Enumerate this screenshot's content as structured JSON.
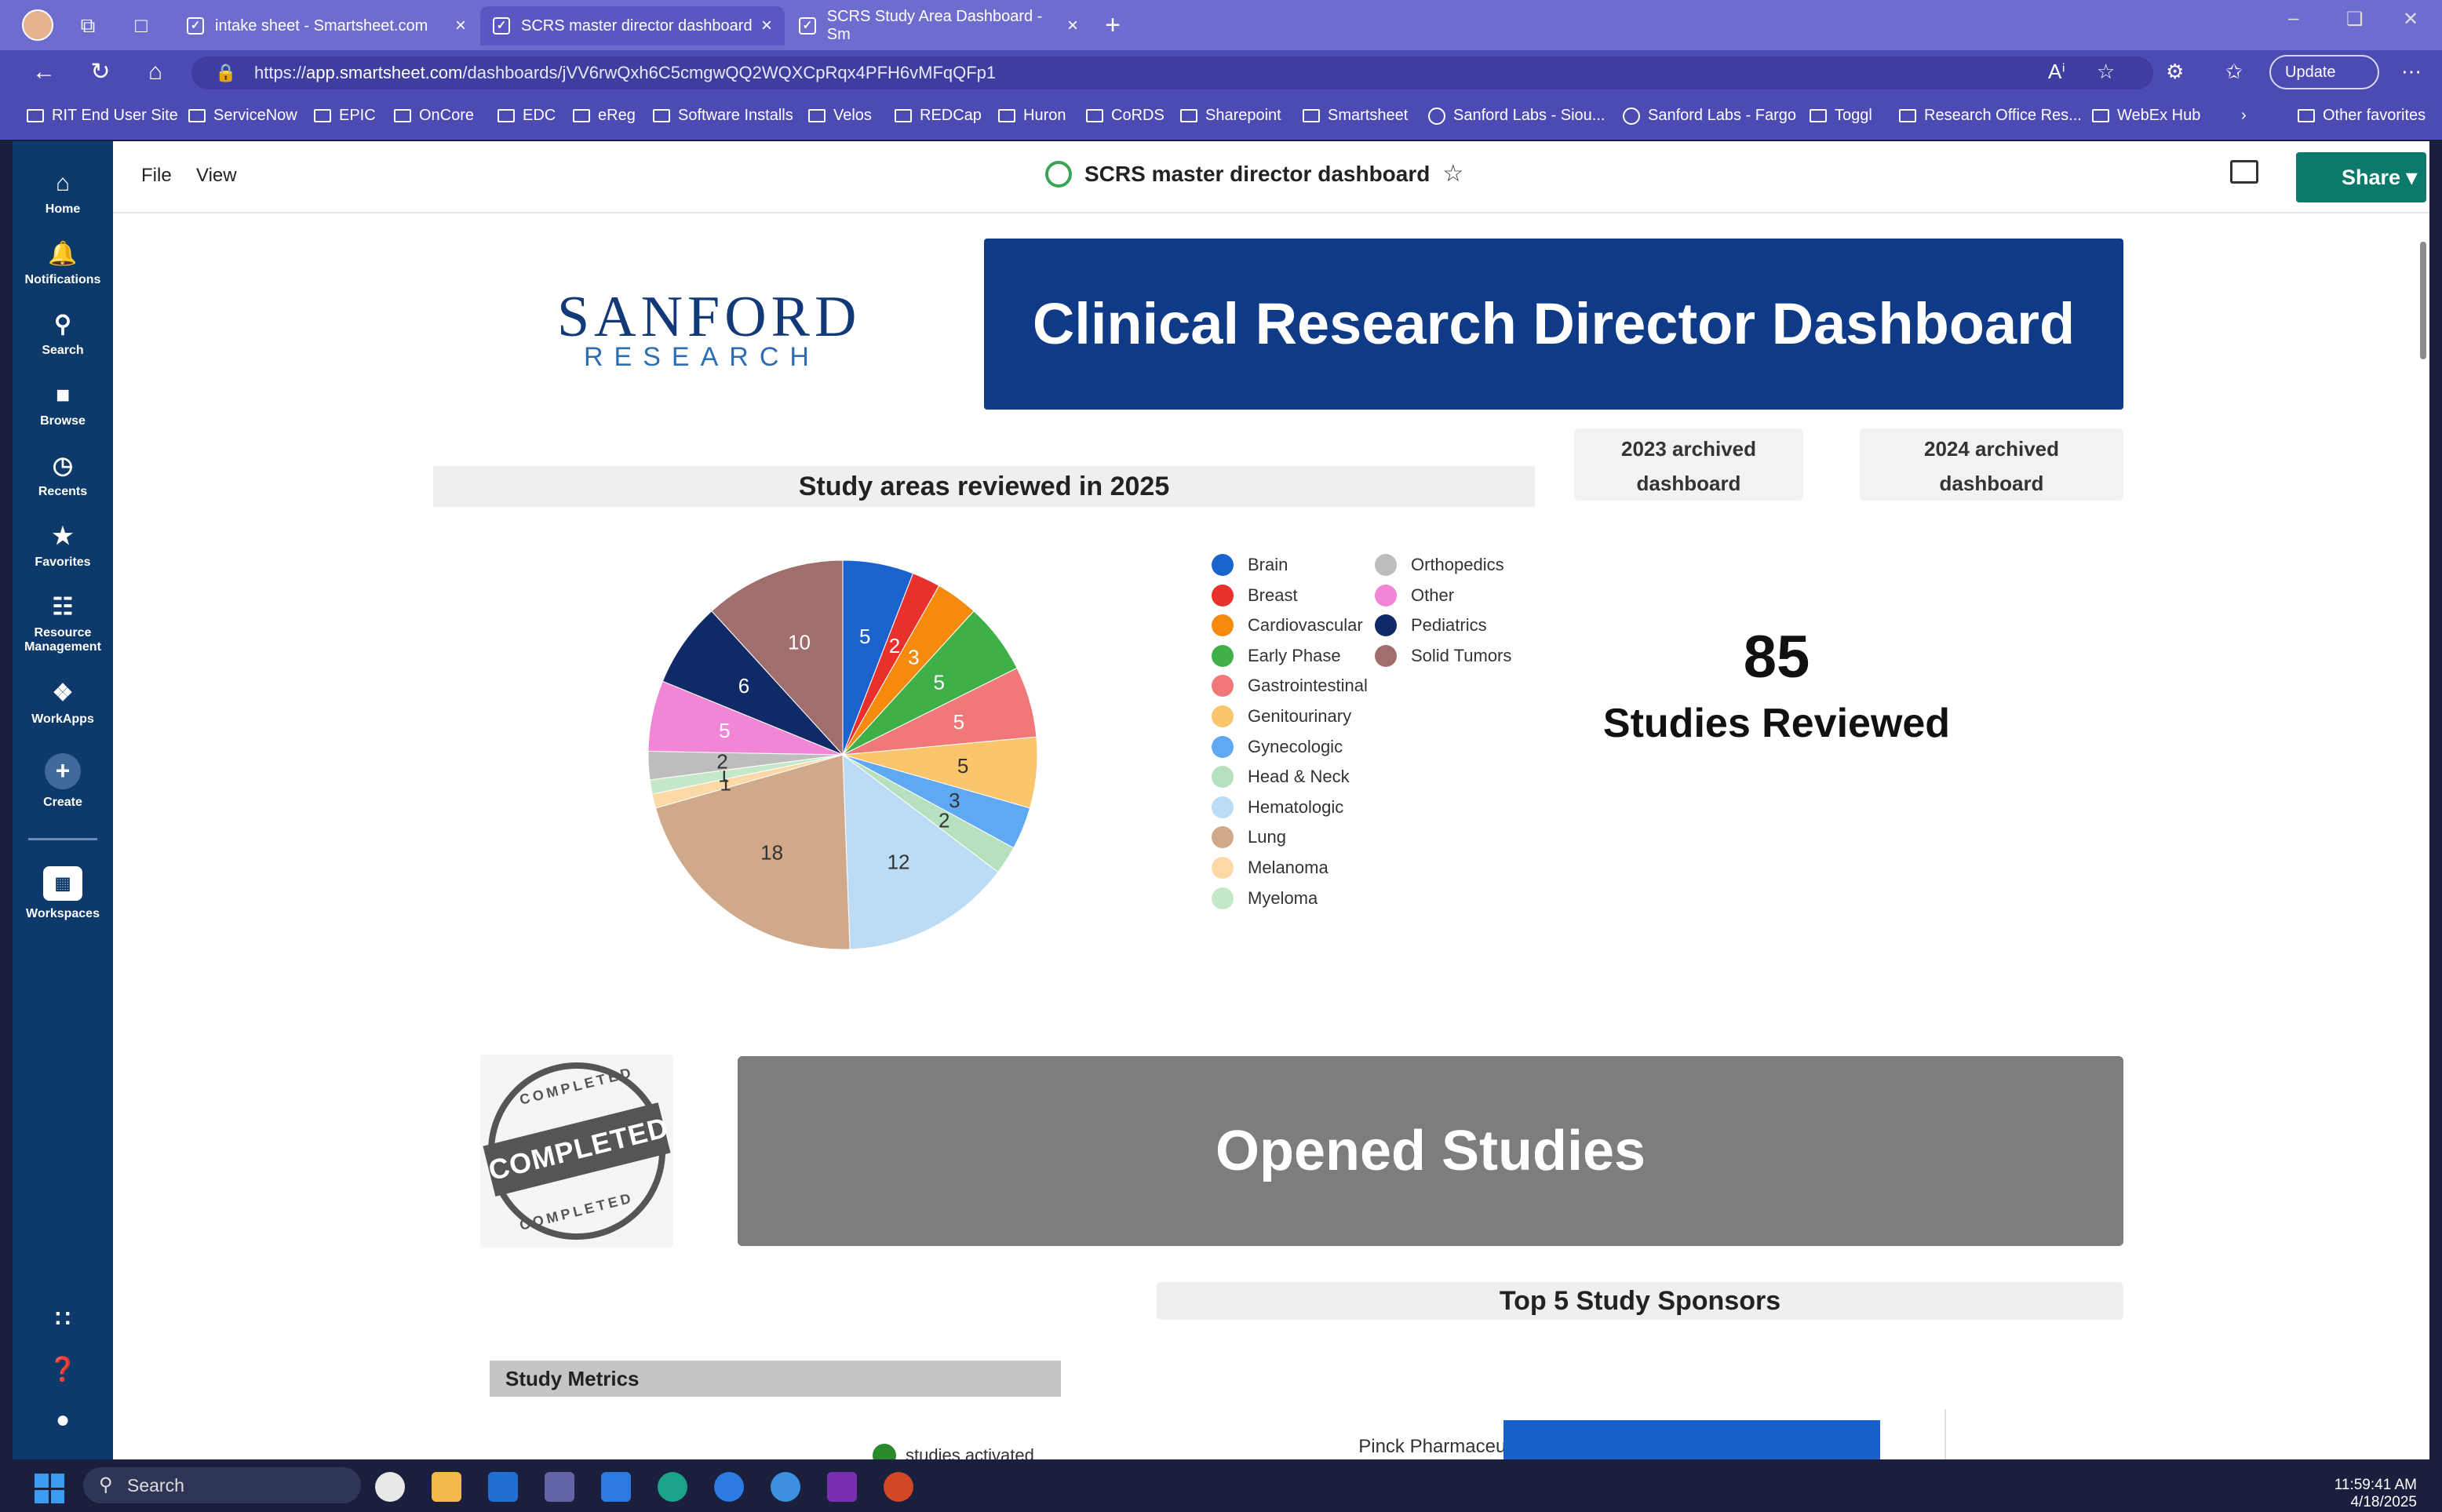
{
  "browser": {
    "tabs": [
      {
        "label": "intake sheet - Smartsheet.com"
      },
      {
        "label": "SCRS master director dashboard"
      },
      {
        "label": "SCRS Study Area Dashboard - Sm"
      }
    ],
    "new_tab": "+",
    "url_prefix": "https://",
    "url_host": "app.smartsheet.com",
    "url_path": "/dashboards/jVV6rwQxh6C5cmgwQQ2WQXCpRqx4PFH6vMFqQFp1",
    "update_label": "Update",
    "favorites": [
      {
        "label": "RIT End User Site",
        "icon": "folder-icon"
      },
      {
        "label": "ServiceNow",
        "icon": "folder-icon"
      },
      {
        "label": "EPIC",
        "icon": "folder-icon"
      },
      {
        "label": "OnCore",
        "icon": "folder-icon"
      },
      {
        "label": "EDC",
        "icon": "folder-icon"
      },
      {
        "label": "eReg",
        "icon": "folder-icon"
      },
      {
        "label": "Software Installs",
        "icon": "folder-icon"
      },
      {
        "label": "Velos",
        "icon": "folder-icon"
      },
      {
        "label": "REDCap",
        "icon": "folder-icon"
      },
      {
        "label": "Huron",
        "icon": "folder-icon"
      },
      {
        "label": "CoRDS",
        "icon": "folder-icon"
      },
      {
        "label": "Sharepoint",
        "icon": "folder-icon"
      },
      {
        "label": "Smartsheet",
        "icon": "folder-icon"
      },
      {
        "label": "Sanford Labs - Siou...",
        "icon": "globe-icon"
      },
      {
        "label": "Sanford Labs - Fargo",
        "icon": "globe-icon"
      },
      {
        "label": "Toggl",
        "icon": "toggl-icon"
      },
      {
        "label": "Research Office Res...",
        "icon": "link-icon"
      },
      {
        "label": "WebEx Hub",
        "icon": "webex-icon"
      }
    ],
    "other_favorites": "Other favorites"
  },
  "leftnav": {
    "items": [
      {
        "label": "Home",
        "icon": "home-icon"
      },
      {
        "label": "Notifications",
        "icon": "bell-icon"
      },
      {
        "label": "Search",
        "icon": "search-icon"
      },
      {
        "label": "Browse",
        "icon": "folder-icon"
      },
      {
        "label": "Recents",
        "icon": "clock-icon"
      },
      {
        "label": "Favorites",
        "icon": "star-icon"
      },
      {
        "label": "Resource",
        "label2": "Management",
        "icon": "resource-icon"
      },
      {
        "label": "WorkApps",
        "icon": "workapps-icon"
      },
      {
        "label": "Create",
        "icon": "plus-icon"
      },
      {
        "label": "Workspaces",
        "icon": "workspaces-icon"
      }
    ]
  },
  "app": {
    "menu_file": "File",
    "menu_view": "View",
    "title": "SCRS master director dashboard",
    "share_label": "Share"
  },
  "dashboard": {
    "logo_main": "SANFORD",
    "logo_sub": "RESEARCH",
    "hero_title": "Clinical Research Director Dashboard",
    "archived_2023": [
      "2023 archived",
      "dashboard"
    ],
    "archived_2024": [
      "2024 archived",
      "dashboard"
    ],
    "pie_title": "Study areas reviewed in 2025",
    "metric_value": "85",
    "metric_label": "Studies Reviewed",
    "stamp_text": "COMPLETED",
    "opened_title": "Opened Studies",
    "sponsors_title": "Top 5 Study Sponsors",
    "metrics_title": "Study Metrics",
    "activated_legend": "studies activated",
    "sponsor_first": "Pinck Pharmaceuticals"
  },
  "chart_data": [
    {
      "type": "pie",
      "title": "Study areas reviewed in 2025",
      "legend": "right",
      "slices": [
        {
          "label": "Brain",
          "value": 5,
          "color": "#1a63cf"
        },
        {
          "label": "Breast",
          "value": 2,
          "color": "#e8312d"
        },
        {
          "label": "Cardiovascular",
          "value": 3,
          "color": "#f58a0c"
        },
        {
          "label": "Early Phase",
          "value": 5,
          "color": "#3fb048"
        },
        {
          "label": "Gastrointestinal",
          "value": 5,
          "color": "#f07878"
        },
        {
          "label": "Genitourinary",
          "value": 5,
          "color": "#fbc56c"
        },
        {
          "label": "Gynecologic",
          "value": 3,
          "color": "#5ea9f2"
        },
        {
          "label": "Head & Neck",
          "value": 2,
          "color": "#b7e0bf"
        },
        {
          "label": "Hematologic",
          "value": 12,
          "color": "#bcdcf6"
        },
        {
          "label": "Lung",
          "value": 18,
          "color": "#cfa98a"
        },
        {
          "label": "Melanoma",
          "value": 1,
          "color": "#fbd8a4"
        },
        {
          "label": "Myeloma",
          "value": 1,
          "color": "#c4e8c8"
        },
        {
          "label": "Orthopedics",
          "value": 2,
          "color": "#bdbdbd"
        },
        {
          "label": "Other",
          "value": 5,
          "color": "#f285d6"
        },
        {
          "label": "Pediatrics",
          "value": 6,
          "color": "#0f2a66"
        },
        {
          "label": "Solid Tumors",
          "value": 10,
          "color": "#a06e6c"
        }
      ]
    },
    {
      "type": "bar",
      "title": "Top 5 Study Sponsors",
      "categories": [
        "Pinck Pharmaceuticals"
      ]
    }
  ],
  "taskbar": {
    "search": "Search",
    "time": "11:59:41 AM",
    "date": "4/18/2025"
  }
}
